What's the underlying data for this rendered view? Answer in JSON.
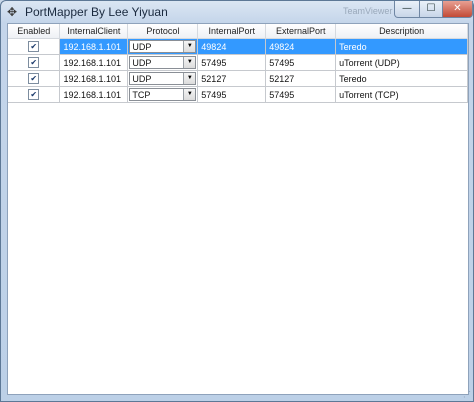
{
  "window": {
    "title": "PortMapper By Lee Yiyuan",
    "background_hint": "TeamViewer"
  },
  "controls": {
    "minimize": "—",
    "maximize": "☐",
    "close": "✕"
  },
  "table": {
    "columns": [
      "Enabled",
      "InternalClient",
      "Protocol",
      "InternalPort",
      "ExternalPort",
      "Description"
    ],
    "rows": [
      {
        "enabled": true,
        "client": "192.168.1.101",
        "protocol": "UDP",
        "internal_port": "49824",
        "external_port": "49824",
        "description": "Teredo"
      },
      {
        "enabled": true,
        "client": "192.168.1.101",
        "protocol": "UDP",
        "internal_port": "57495",
        "external_port": "57495",
        "description": "uTorrent (UDP)"
      },
      {
        "enabled": true,
        "client": "192.168.1.101",
        "protocol": "UDP",
        "internal_port": "52127",
        "external_port": "52127",
        "description": "Teredo"
      },
      {
        "enabled": true,
        "client": "192.168.1.101",
        "protocol": "TCP",
        "internal_port": "57495",
        "external_port": "57495",
        "description": "uTorrent (TCP)"
      }
    ]
  },
  "colors": {
    "selection": "#3399ff",
    "frame": "#c4d5ea"
  },
  "icons": {
    "app": "app-move-icon",
    "checkbox": "checkmark-icon",
    "dropdown": "chevron-down-icon"
  }
}
